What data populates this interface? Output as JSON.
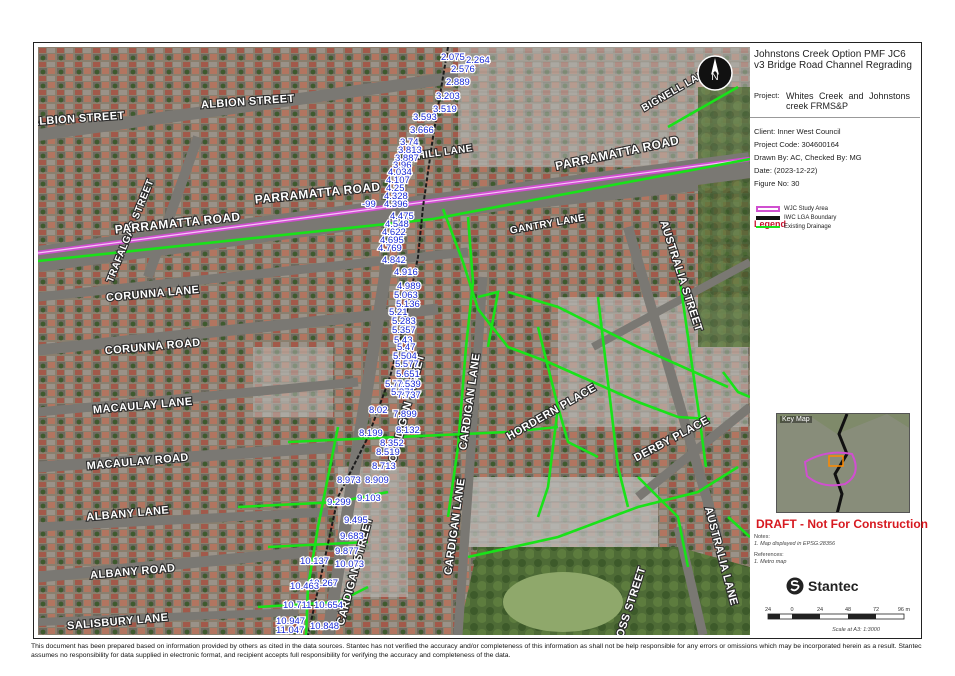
{
  "title": "Johnstons Creek Option PMF JC6 v3 Bridge Road Channel Regrading",
  "project_label": "Project:",
  "project_value": "Whites Creek and Johnstons creek FRMS&P",
  "client": "Client:  Inner West Council",
  "project_code": "Project Code:  304600164",
  "drawn_by": "Drawn By:  AC, Checked By: MG",
  "date": "Date:  (2023-12-22)",
  "figure_no": "Figure No:  30",
  "legend": {
    "title": "Legend",
    "items": [
      {
        "label": "WJC Study Area",
        "color": "#d04fd0"
      },
      {
        "label": "IWC LGA Boundary",
        "color": "#111111"
      },
      {
        "label": "Existing Drainage",
        "color": "#19e219"
      }
    ]
  },
  "key_map_label": "Key Map",
  "draft_text": "DRAFT - Not For Construction",
  "notes_label": "Notes:",
  "notes": "1. Map displayed in EPSG:28356",
  "references_label": "References:",
  "references": "1. Metro map",
  "logo_text": "Stantec",
  "north_arrow": "N",
  "scale": {
    "ticks": [
      "24",
      "0",
      "24",
      "48",
      "72",
      "96 m"
    ],
    "label": "Scale at A3: 1:3000"
  },
  "disclaimer": "This document has been prepared based on information provided by others as cited in the data sources. Stantec has not verified the accuracy and/or completeness of this information as shall not be help responsible for any errors or omissions which may be incorporated herein as a result. Stantec assumes no responsibility for data supplied in electronic format, and recipient accepts full responsibility for verifying the accuracy and completeness of the data.",
  "streets": [
    "ALBION STREET",
    "ALBION STREET",
    "TRAFALGAR STREET",
    "CAHILL LANE",
    "PARRAMATTA ROAD",
    "PARRAMATTA ROAD",
    "PARRAMATTA ROAD",
    "BIGNELL LANE",
    "GANTRY LANE",
    "CORUNNA LANE",
    "CORUNNA ROAD",
    "MACAULAY LANE",
    "MACAULAY ROAD",
    "ALBANY LANE",
    "ALBANY ROAD",
    "SALISBURY LANE",
    "CARDIGAN STREET",
    "CARDIGAN STREET",
    "CARDIGAN LANE",
    "CARDIGAN LANE",
    "HORDERN PLACE",
    "DERBY PLACE",
    "AUSTRALIA STREET",
    "AUSTRALIA LANE",
    "ROSS STREET"
  ],
  "levels": [
    "2.075",
    "2.264",
    "2.576",
    "2.889",
    "3.203",
    "3.519",
    "3.593",
    "3.666",
    "3.74",
    "3.813",
    "3.887",
    "3.96",
    "4.034",
    "4.107",
    "4.25",
    "4.328",
    "4.396",
    "-99",
    "4.475",
    "4.548",
    "4.622",
    "4.695",
    "4.769",
    "4.842",
    "4.916",
    "4.989",
    "5.063",
    "5.136",
    "5.21",
    "5.283",
    "5.357",
    "5.43",
    "5.47",
    "5.504",
    "5.577",
    "5.651",
    "5.724",
    "5.871",
    "7.539",
    "7.737",
    "8.02",
    "7.899",
    "8.132",
    "8.199",
    "8.352",
    "8.519",
    "8.713",
    "8.973",
    "8.909",
    "9.299",
    "9.103",
    "9.495",
    "9.683",
    "9.877",
    "10.137",
    "10.073",
    "10.267",
    "10.463",
    "10.654",
    "10.711",
    "10.947",
    "10.848",
    "11.047"
  ]
}
